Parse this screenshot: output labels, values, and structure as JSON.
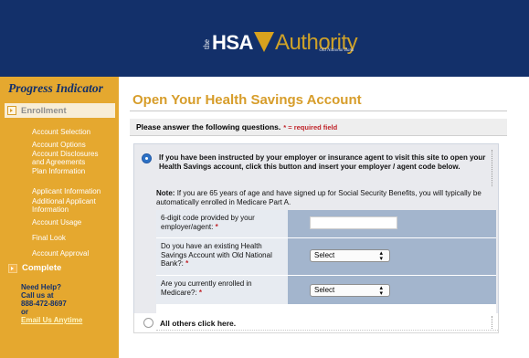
{
  "brand": {
    "the": "the",
    "hsa": "HSA",
    "authority": "Authority",
    "sub": "Old National Bank",
    "colors": {
      "navy": "#13306a",
      "gold": "#e5a82f"
    }
  },
  "sidebar": {
    "title": "Progress Indicator",
    "enrollment": "Enrollment",
    "items": [
      "Account Selection",
      "Account Options",
      "Account Disclosures",
      "and Agreements",
      "Plan Information",
      "Applicant Information",
      "Additional Applicant",
      "Information",
      "Account Usage",
      "Final Look",
      "Account Approval"
    ],
    "complete": "Complete",
    "help": {
      "line1": "Need Help?",
      "line2": "Call us at",
      "phone": "888-472-8697",
      "or": "or",
      "email": "Email Us Anytime"
    }
  },
  "main": {
    "title": "Open Your Health Savings Account",
    "instructions": "Please answer the following questions.",
    "required_note": "* = required field",
    "option1": {
      "text": "If you have been instructed by your employer or insurance agent to visit this site to open your Health Savings account, click this button and insert your employer / agent code below.",
      "note_label": "Note:",
      "note_text": "If you are 65 years of age and have signed up for Social Security Benefits, you will typically be automatically enrolled in Medicare Part A."
    },
    "fields": {
      "code_label": "6-digit code provided by your employer/agent:",
      "code_value": "",
      "bank_label": "Do you have an existing Health Savings Account with Old National Bank?:",
      "bank_value": "Select",
      "medicare_label": "Are you currently enrolled in Medicare?:",
      "medicare_value": "Select",
      "required_mark": "*"
    },
    "option2": {
      "text": "All others click here."
    }
  }
}
